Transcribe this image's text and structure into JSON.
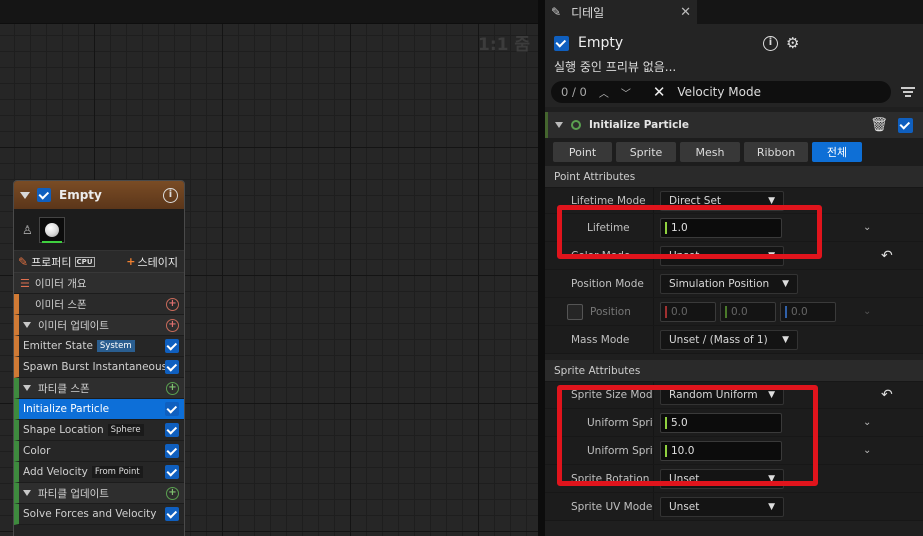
{
  "graph": {
    "zoom_label": "1:1 줌"
  },
  "node": {
    "title": "Empty",
    "tab_properties": "프로퍼티",
    "tab_cpu": "CPU",
    "tab_stage": "스테이지",
    "emitter_summary": "이미터 개요",
    "emitter_spawn": "이미터 스폰",
    "emitter_update": "이미터 업데이트",
    "emitter_state": "Emitter State",
    "emitter_state_tag": "System",
    "spawn_burst": "Spawn Burst Instantaneous",
    "particle_spawn": "파티클 스폰",
    "initialize_particle": "Initialize Particle",
    "shape_location": "Shape Location",
    "shape_location_tag": "Sphere",
    "color": "Color",
    "add_velocity": "Add Velocity",
    "add_velocity_tag": "From Point",
    "particle_update": "파티클 업데이트",
    "solve_forces": "Solve Forces and Velocity"
  },
  "details": {
    "tab_title": "디테일",
    "emitter_name": "Empty",
    "subtitle": "실행 중인 프리뷰 없음...",
    "search": {
      "count": "0 / 0",
      "query": "Velocity Mode"
    },
    "module_title": "Initialize Particle",
    "filters": [
      "Point",
      "Sprite",
      "Mesh",
      "Ribbon",
      "전체"
    ],
    "active_filter_index": 4,
    "point_attributes": "Point Attributes",
    "lifetime_mode_label": "Lifetime Mode",
    "lifetime_mode_value": "Direct Set",
    "lifetime_label": "Lifetime",
    "lifetime_value": "1.0",
    "color_mode_label": "Color Mode",
    "color_mode_value": "Unset",
    "position_mode_label": "Position Mode",
    "position_mode_value": "Simulation Position",
    "position_label": "Position",
    "position_x": "0.0",
    "position_y": "0.0",
    "position_z": "0.0",
    "mass_mode_label": "Mass Mode",
    "mass_mode_value": "Unset / (Mass of 1)",
    "sprite_attributes": "Sprite Attributes",
    "sprite_size_mode_label": "Sprite Size Mode",
    "sprite_size_mode_value": "Random Uniform",
    "uniform_min_label": "Uniform Sprite Size Min",
    "uniform_min_value": "5.0",
    "uniform_max_label": "Uniform Sprite Size Max",
    "uniform_max_value": "10.0",
    "sprite_rotation_label": "Sprite Rotation Mode",
    "sprite_rotation_value": "Unset",
    "sprite_uv_label": "Sprite UV Mode",
    "sprite_uv_value": "Unset"
  },
  "colors": {
    "accent_blue": "#0e6fd6",
    "highlight_red": "#e0141c",
    "module_green": "#5aa050"
  }
}
